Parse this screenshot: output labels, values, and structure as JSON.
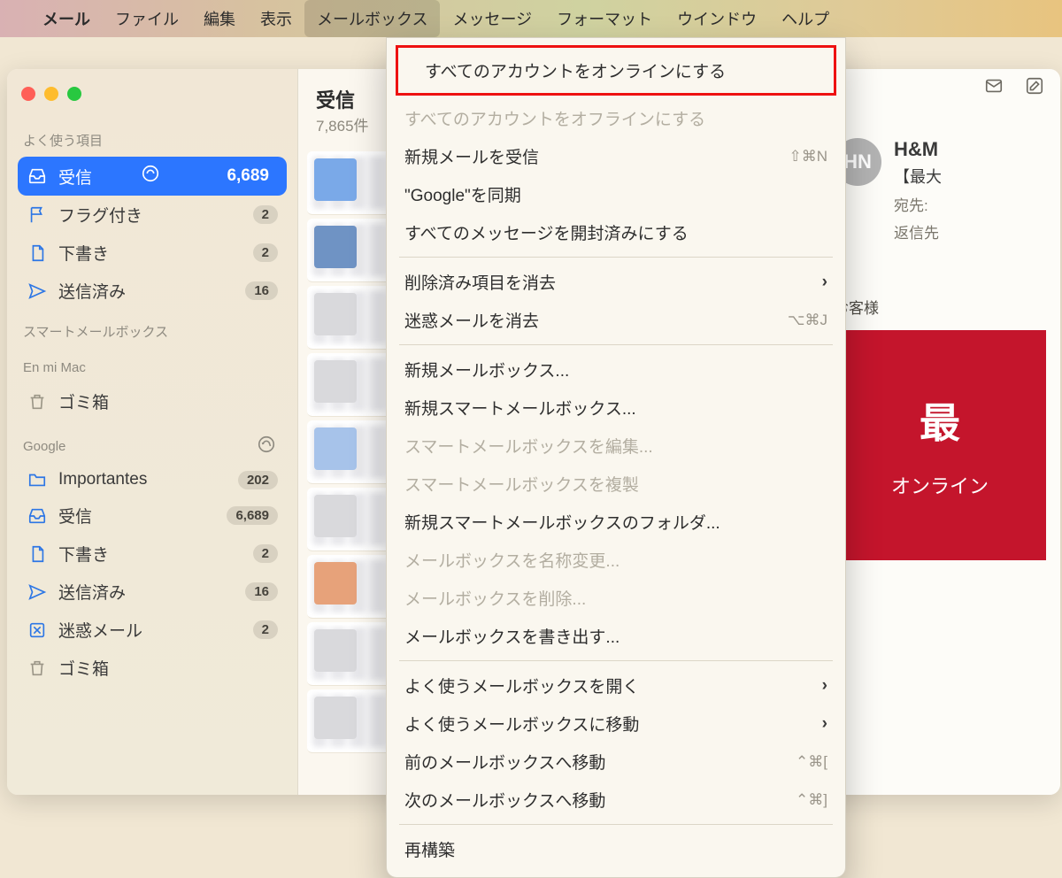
{
  "menubar": {
    "app": "メール",
    "items": [
      "ファイル",
      "編集",
      "表示",
      "メールボックス",
      "メッセージ",
      "フォーマット",
      "ウインドウ",
      "ヘルプ"
    ],
    "active_index": 3
  },
  "sidebar": {
    "favorites_label": "よく使う項目",
    "items": [
      {
        "icon": "inbox",
        "label": "受信",
        "count": "6,689",
        "selected": true,
        "status": true
      },
      {
        "icon": "flag",
        "label": "フラグ付き",
        "count": "2"
      },
      {
        "icon": "doc",
        "label": "下書き",
        "count": "2"
      },
      {
        "icon": "send",
        "label": "送信済み",
        "count": "16"
      }
    ],
    "smart_label": "スマートメールボックス",
    "local_label": "En mi Mac",
    "local_items": [
      {
        "icon": "trash",
        "label": "ゴミ箱"
      }
    ],
    "account_label": "Google",
    "account_items": [
      {
        "icon": "folder",
        "label": "Importantes",
        "count": "202"
      },
      {
        "icon": "inbox",
        "label": "受信",
        "count": "6,689"
      },
      {
        "icon": "doc",
        "label": "下書き",
        "count": "2"
      },
      {
        "icon": "send",
        "label": "送信済み",
        "count": "16"
      },
      {
        "icon": "junk",
        "label": "迷惑メール",
        "count": "2"
      },
      {
        "icon": "trash",
        "label": "ゴミ箱"
      }
    ]
  },
  "list": {
    "title": "受信",
    "subtitle": "7,865件"
  },
  "preview": {
    "avatar": "HN",
    "sender": "H&M",
    "subject": "【最大",
    "to_label": "宛先:",
    "reply_label": "返信先",
    "greeting": "お客様",
    "banner_big": "最",
    "banner_small": "オンライン"
  },
  "dropdown": {
    "items": [
      {
        "label": "すべてのアカウントをオンラインにする",
        "highlight": true
      },
      {
        "label": "すべてのアカウントをオフラインにする",
        "disabled": true
      },
      {
        "label": "新規メールを受信",
        "shortcut": "⇧⌘N"
      },
      {
        "label": "\"Google\"を同期"
      },
      {
        "label": "すべてのメッセージを開封済みにする"
      },
      {
        "sep": true
      },
      {
        "label": "削除済み項目を消去",
        "submenu": true
      },
      {
        "label": "迷惑メールを消去",
        "shortcut": "⌥⌘J"
      },
      {
        "sep": true
      },
      {
        "label": "新規メールボックス..."
      },
      {
        "label": "新規スマートメールボックス..."
      },
      {
        "label": "スマートメールボックスを編集...",
        "disabled": true
      },
      {
        "label": "スマートメールボックスを複製",
        "disabled": true
      },
      {
        "label": "新規スマートメールボックスのフォルダ..."
      },
      {
        "label": "メールボックスを名称変更...",
        "disabled": true
      },
      {
        "label": "メールボックスを削除...",
        "disabled": true
      },
      {
        "label": "メールボックスを書き出す..."
      },
      {
        "sep": true
      },
      {
        "label": "よく使うメールボックスを開く",
        "submenu": true
      },
      {
        "label": "よく使うメールボックスに移動",
        "submenu": true
      },
      {
        "label": "前のメールボックスへ移動",
        "shortcut": "⌃⌘["
      },
      {
        "label": "次のメールボックスへ移動",
        "shortcut": "⌃⌘]"
      },
      {
        "sep": true
      },
      {
        "label": "再構築"
      }
    ]
  }
}
